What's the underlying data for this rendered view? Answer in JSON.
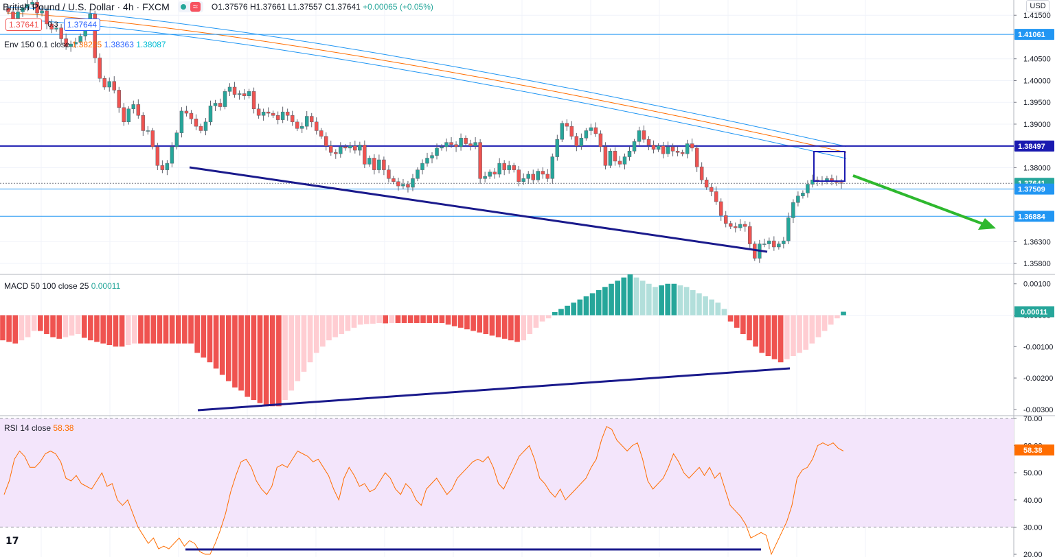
{
  "header": {
    "symbol": "British Pound / U.S. Dollar · 4h · FXCM",
    "open": "O1.37576",
    "high": "H1.37661",
    "low": "L1.37557",
    "close": "C1.37641",
    "change": "+0.00065 (+0.05%)",
    "bid": "1.37641",
    "spread": "0.3",
    "ask": "1.37644",
    "currency": "USD"
  },
  "indicators": {
    "env_label": "Env 150 0.1 close",
    "env_basis": "1.38225",
    "env_upper": "1.38363",
    "env_lower": "1.38087",
    "macd_label": "MACD 50 100 close 25",
    "macd_value": "0.00011",
    "rsi_label": "RSI 14 close",
    "rsi_value": "58.38"
  },
  "colors": {
    "up": "#26a69a",
    "down": "#ef5350",
    "env_basis": "#ff6d00",
    "env_bands": "#2196f3",
    "rsi_line": "#ff6d00",
    "rsi_band": "#f3e5fb",
    "annotation": "#1a1a8c",
    "arrow": "#2eb82e"
  },
  "chart_data": [
    {
      "type": "candlestick",
      "panel": "price",
      "ylim": [
        1.3555,
        1.4185
      ],
      "yticks": [
        "1.41500",
        "1.40500",
        "1.40000",
        "1.39500",
        "1.39000",
        "1.38000",
        "1.36300",
        "1.35800"
      ],
      "levels": [
        {
          "value": 1.41061,
          "label": "1.41061",
          "style": "thin"
        },
        {
          "value": 1.38497,
          "label": "1.38497",
          "style": "thick"
        },
        {
          "value": 1.37641,
          "label": "1.37641",
          "style": "current"
        },
        {
          "value": 1.37509,
          "label": "1.37509",
          "style": "thin"
        },
        {
          "value": 1.36884,
          "label": "1.36884",
          "style": "thin"
        }
      ],
      "close_path": [
        1.4158,
        1.414,
        1.4158,
        1.4168,
        1.4175,
        1.418,
        1.4155,
        1.416,
        1.413,
        1.4118,
        1.4121,
        1.4096,
        1.4078,
        1.4084,
        1.4088,
        1.4102,
        1.4126,
        1.4153,
        1.4052,
        1.4005,
        1.3985,
        1.3998,
        1.3978,
        1.3938,
        1.3905,
        1.3935,
        1.3945,
        1.392,
        1.3885,
        1.3885,
        1.3848,
        1.3805,
        1.3795,
        1.381,
        1.3848,
        1.388,
        1.393,
        1.3925,
        1.3912,
        1.3895,
        1.3885,
        1.3905,
        1.3942,
        1.3948,
        1.394,
        1.3975,
        1.3985,
        1.3968,
        1.397,
        1.3965,
        1.3975,
        1.3935,
        1.392,
        1.3928,
        1.3925,
        1.392,
        1.391,
        1.3928,
        1.392,
        1.3905,
        1.389,
        1.3895,
        1.3918,
        1.3905,
        1.3885,
        1.3872,
        1.385,
        1.3835,
        1.3832,
        1.3848,
        1.3845,
        1.385,
        1.384,
        1.3852,
        1.3808,
        1.3822,
        1.3795,
        1.3818,
        1.3795,
        1.3775,
        1.3768,
        1.3758,
        1.3762,
        1.3755,
        1.3775,
        1.3795,
        1.381,
        1.3822,
        1.3828,
        1.3845,
        1.3848,
        1.3858,
        1.3853,
        1.3848,
        1.3868,
        1.3855,
        1.385,
        1.3858,
        1.3775,
        1.378,
        1.379,
        1.3785,
        1.381,
        1.3795,
        1.3805,
        1.3795,
        1.3768,
        1.3775,
        1.3785,
        1.3772,
        1.3792,
        1.3785,
        1.3775,
        1.3825,
        1.3865,
        1.3902,
        1.3895,
        1.3872,
        1.385,
        1.3868,
        1.3885,
        1.3892,
        1.3878,
        1.3848,
        1.3805,
        1.3838,
        1.3815,
        1.3808,
        1.3825,
        1.3838,
        1.386,
        1.3885,
        1.3865,
        1.3852,
        1.3842,
        1.385,
        1.3832,
        1.3848,
        1.3838,
        1.3835,
        1.3832,
        1.3855,
        1.3845,
        1.3802,
        1.3772,
        1.3755,
        1.3745,
        1.3722,
        1.369,
        1.3672,
        1.3665,
        1.3662,
        1.367,
        1.3665,
        1.3625,
        1.3592,
        1.3625,
        1.3625,
        1.3632,
        1.3618,
        1.3625,
        1.3632,
        1.3685,
        1.372,
        1.3735,
        1.3742,
        1.3762,
        1.3772,
        1.377,
        1.3768,
        1.3775,
        1.377,
        1.3766,
        1.3764
      ],
      "annotations": [
        "lower trendline",
        "highlight box around last candles",
        "green arrow pointing down-right"
      ]
    },
    {
      "type": "bar",
      "panel": "macd",
      "label": "MACD 50 100 close 25",
      "ylim": [
        -0.0032,
        0.0013
      ],
      "yticks": [
        "0.00100",
        "0.00000",
        "-0.00100",
        "-0.00200",
        "-0.00300"
      ],
      "histogram": [
        -0.0008,
        -0.00085,
        -0.0009,
        -0.0008,
        -0.0007,
        -0.0005,
        -0.0005,
        -0.0006,
        -0.0007,
        -0.00075,
        -0.0007,
        -0.00065,
        -0.0006,
        -0.00072,
        -0.0008,
        -0.00085,
        -0.0009,
        -0.00095,
        -0.001,
        -0.001,
        -0.00095,
        -0.0009,
        -0.0009,
        -0.0009,
        -0.0009,
        -0.0009,
        -0.0009,
        -0.0009,
        -0.0009,
        -0.0009,
        -0.0009,
        -0.0012,
        -0.00135,
        -0.0015,
        -0.0017,
        -0.0019,
        -0.0021,
        -0.0023,
        -0.0024,
        -0.0026,
        -0.0027,
        -0.0028,
        -0.0029,
        -0.0029,
        -0.0029,
        -0.0027,
        -0.0024,
        -0.0021,
        -0.0018,
        -0.0015,
        -0.0012,
        -0.001,
        -0.0008,
        -0.0007,
        -0.0006,
        -0.0005,
        -0.0004,
        -0.0003,
        -0.00028,
        -0.00027,
        -0.00025,
        -0.00026,
        -0.00025,
        -0.00025,
        -0.00025,
        -0.00025,
        -0.00025,
        -0.00025,
        -0.00025,
        -0.00025,
        -0.00025,
        -0.0003,
        -0.00035,
        -0.0004,
        -0.00045,
        -0.0005,
        -0.00055,
        -0.0006,
        -0.00065,
        -0.0007,
        -0.00075,
        -0.0008,
        -0.00085,
        -0.0008,
        -0.0006,
        -0.0004,
        -0.0002,
        -0.0001,
        0.0001,
        0.0002,
        0.0003,
        0.0004,
        0.0005,
        0.0006,
        0.0007,
        0.0008,
        0.0009,
        0.001,
        0.0011,
        0.0012,
        0.0013,
        0.0012,
        0.0011,
        0.001,
        0.0009,
        0.00095,
        0.001,
        0.001,
        0.00095,
        0.0009,
        0.0008,
        0.0007,
        0.0006,
        0.0005,
        0.0004,
        0.0002,
        -0.0002,
        -0.0004,
        -0.0006,
        -0.0008,
        -0.001,
        -0.0012,
        -0.0013,
        -0.0014,
        -0.0015,
        -0.0014,
        -0.0013,
        -0.0012,
        -0.0011,
        -0.0009,
        -0.0007,
        -0.0005,
        -0.0003,
        -0.0001,
        0.00011
      ],
      "value": 0.00011,
      "annotations": [
        "rising trendline under histogram lows"
      ]
    },
    {
      "type": "line",
      "panel": "rsi",
      "label": "RSI 14 close",
      "ylim": [
        19,
        71
      ],
      "yticks": [
        "70.00",
        "60.00",
        "50.00",
        "40.00",
        "30.00",
        "20.00"
      ],
      "band": [
        30,
        70
      ],
      "values": [
        42,
        47,
        55,
        58,
        56,
        52,
        52,
        54,
        57,
        58,
        57,
        54,
        48,
        47,
        49,
        46,
        45,
        44,
        47,
        50,
        45,
        46,
        40,
        38,
        40,
        35,
        30,
        27,
        24,
        26,
        22,
        23,
        22,
        24,
        26,
        23,
        25,
        24,
        21,
        20,
        20,
        24,
        29,
        35,
        43,
        49,
        54,
        55,
        52,
        47,
        44,
        42,
        45,
        52,
        53,
        52,
        55,
        58,
        57,
        56,
        54,
        55,
        52,
        49,
        44,
        40,
        48,
        52,
        49,
        45,
        46,
        43,
        44,
        47,
        50,
        48,
        44,
        42,
        46,
        44,
        40,
        38,
        44,
        46,
        48,
        45,
        42,
        44,
        48,
        50,
        52,
        54,
        55,
        54,
        56,
        52,
        46,
        44,
        48,
        52,
        56,
        58,
        60,
        55,
        48,
        46,
        43,
        41,
        44,
        40,
        42,
        44,
        46,
        48,
        52,
        55,
        62,
        67,
        66,
        62,
        60,
        58,
        60,
        61,
        55,
        47,
        44,
        46,
        48,
        52,
        57,
        54,
        50,
        48,
        50,
        52,
        49,
        52,
        48,
        50,
        44,
        38,
        36,
        34,
        31,
        26,
        27,
        28,
        27,
        20,
        24,
        28,
        32,
        38,
        48,
        51,
        52,
        55,
        60,
        61,
        60,
        61,
        59,
        58
      ],
      "value": 58.38,
      "annotations": [
        "horizontal line at RSI lows"
      ]
    }
  ]
}
